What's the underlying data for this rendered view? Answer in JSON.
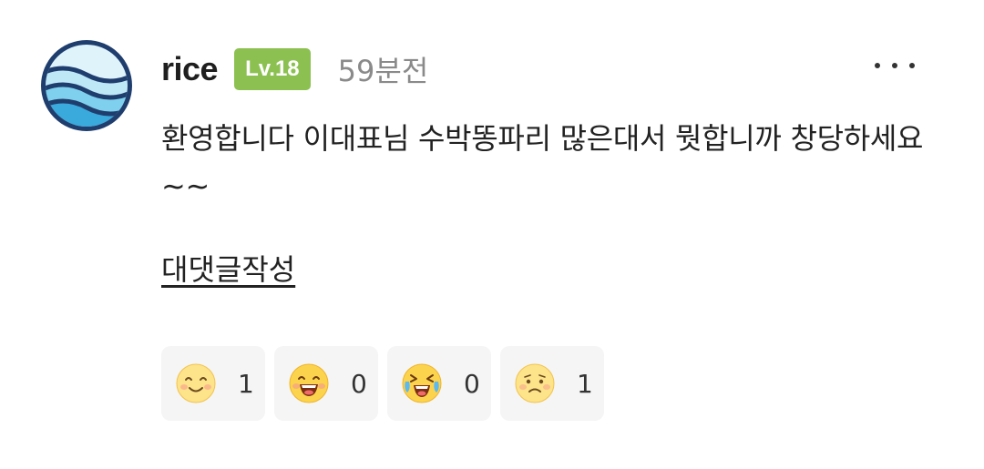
{
  "comment": {
    "author": "rice",
    "level": "Lv.18",
    "time_ago": "59분전",
    "text": "환영합니다 이대표님 수박똥파리 많은대서 뭣합니까 창당하세요~~",
    "reply_label": "대댓글작성"
  },
  "colors": {
    "level_badge": "#8cc152",
    "muted_text": "#8a8a8a",
    "reaction_bg": "#f5f5f5"
  },
  "reactions": [
    {
      "icon": "smile-icon",
      "count": "1"
    },
    {
      "icon": "laugh-icon",
      "count": "0"
    },
    {
      "icon": "crying-laugh-icon",
      "count": "0"
    },
    {
      "icon": "sad-icon",
      "count": "1"
    }
  ]
}
